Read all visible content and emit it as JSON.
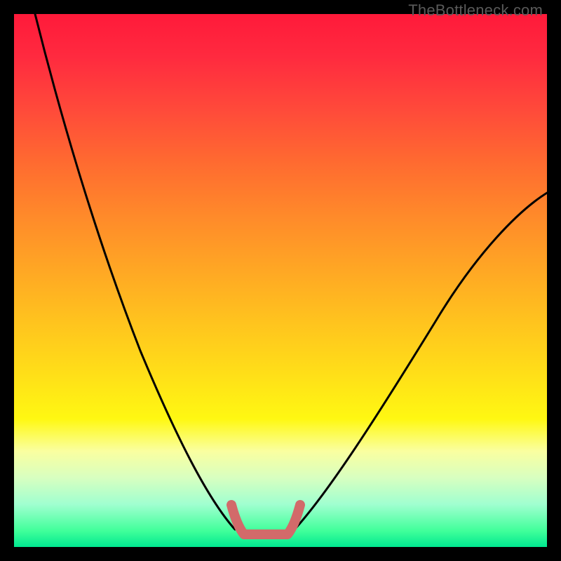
{
  "watermark": "TheBottleneck.com",
  "colors": {
    "frame": "#000000",
    "curve": "#000000",
    "bottom_marker": "#d26a6a",
    "gradient_top": "#ff1a3a",
    "gradient_bottom": "#00e890"
  },
  "chart_data": {
    "type": "line",
    "title": "",
    "xlabel": "",
    "ylabel": "",
    "xlim": [
      0,
      100
    ],
    "ylim": [
      0,
      100
    ],
    "grid": false,
    "legend_position": "none",
    "annotations": [
      "TheBottleneck.com"
    ],
    "series": [
      {
        "name": "left_curve",
        "x": [
          4,
          8,
          12,
          16,
          20,
          24,
          28,
          32,
          36,
          40,
          42
        ],
        "y": [
          100,
          88,
          76,
          64,
          53,
          42,
          32,
          22,
          13,
          5,
          2
        ]
      },
      {
        "name": "right_curve",
        "x": [
          52,
          56,
          60,
          64,
          68,
          72,
          76,
          80,
          84,
          88,
          92,
          96,
          100
        ],
        "y": [
          2,
          5,
          10,
          16,
          22,
          28,
          34,
          40,
          46,
          52,
          57,
          62,
          66
        ]
      },
      {
        "name": "bottom_marker",
        "x": [
          41,
          42,
          43,
          44,
          46,
          48,
          50,
          51,
          52,
          53
        ],
        "y": [
          6,
          3,
          1,
          0,
          0,
          0,
          0,
          1,
          3,
          6
        ]
      }
    ]
  }
}
